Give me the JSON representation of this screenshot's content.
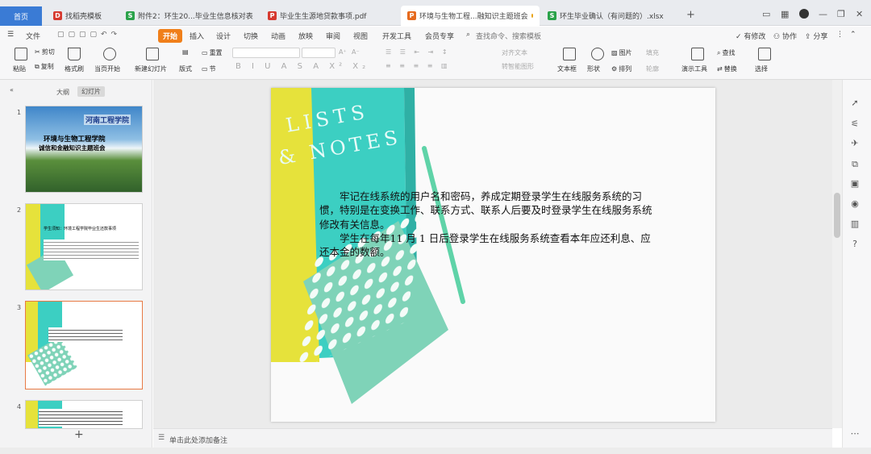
{
  "tabs": [
    {
      "label": "首页"
    },
    {
      "label": "找稻壳模板",
      "icon": "D",
      "color": "#d6392f"
    },
    {
      "label": "附件2：环生20...毕业生信息核对表",
      "icon": "S",
      "color": "#2aa24a"
    },
    {
      "label": "毕业生生源地贷款事项.pdf",
      "icon": "P",
      "color": "#d6392f"
    },
    {
      "label": "环境与生物工程...融知识主题班会",
      "icon": "P",
      "color": "#e66a1e"
    },
    {
      "label": "环生毕业确认（有问题的）.xlsx",
      "icon": "S",
      "color": "#2aa24a"
    }
  ],
  "tab_add": "+",
  "menu": {
    "file": "文件",
    "items": [
      "开始",
      "插入",
      "设计",
      "切换",
      "动画",
      "放映",
      "审阅",
      "视图",
      "开发工具",
      "会员专享"
    ],
    "search": "查找命令、搜索模板",
    "right": [
      "有修改",
      "协作",
      "分享"
    ]
  },
  "ribbon": {
    "paste": "粘贴",
    "cut": "剪切",
    "copy": "复制",
    "format_painter": "格式刷",
    "from_current": "当页开始",
    "new_slide": "新建幻灯片",
    "layout": "版式",
    "section": "节",
    "reset": "重置",
    "font_size_up": "A⁺",
    "font_size_down": "A⁻",
    "text_box": "文本框",
    "shape": "形状",
    "arrange": "排列",
    "picture": "图片",
    "fill": "填充",
    "outline": "轮廓",
    "presentation_tools": "演示工具",
    "find": "查找",
    "replace": "替换",
    "select": "选择",
    "to_smartart": "转智能图形",
    "text_effect": "对齐文本"
  },
  "sidebar": {
    "tab_outline": "大纲",
    "tab_slides": "幻灯片",
    "slides": [
      {
        "num": "1",
        "title_line1": "环境与生物工程学院",
        "title_line2": "诚信和金融知识主题班会",
        "corner": "河南工程学院"
      },
      {
        "num": "2",
        "heading": "学生须知：环境工程学院毕业生还款事项"
      },
      {
        "num": "3"
      },
      {
        "num": "4"
      }
    ],
    "add": "+"
  },
  "slide": {
    "bg_text1": "LISTS",
    "bg_text2": "& NOTES",
    "para1": "牢记在线系统的用户名和密码，养成定期登录学生在线服务系统的习惯，特别是在变换工作、联系方式、联系人后要及时登录学生在线服务系统修改有关信息。",
    "para2": "学生在每年11 月 1 日后登录学生在线服务系统查看本年应还利息、应还本金的数额。"
  },
  "notes_placeholder": "单击此处添加备注",
  "colors": {
    "accent": "#f07f1a",
    "teal": "#3ccfc2",
    "yellow": "#e6e23b",
    "mint": "#7fd3b8"
  }
}
